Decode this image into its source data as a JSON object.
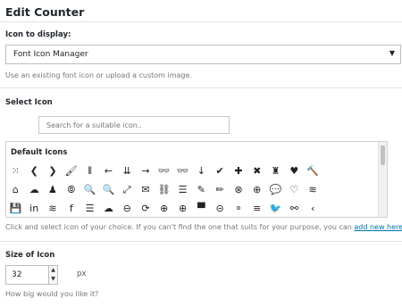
{
  "header": {
    "title": "Edit Counter"
  },
  "icon_display": {
    "label": "Icon to display:",
    "selected": "Font Icon Manager",
    "caret": "▼",
    "help": "Use an existing font icon or upload a custom image."
  },
  "select_icon": {
    "label": "Select Icon",
    "search_placeholder": "Search for a suitable icon..",
    "panel_title": "Default Icons",
    "rows": [
      [
        "⁙",
        "❮",
        "❯",
        "🖌",
        "⦀",
        "←",
        "⇊",
        "→",
        "👓",
        "👓",
        "↓",
        "✔",
        "✚",
        "✖",
        "♜",
        "♥",
        "🔨"
      ],
      [
        "⌂",
        "☁",
        "♟",
        "⦾",
        "🔍",
        "🔍",
        "⤢",
        "✉",
        "⛓",
        "☰",
        "✎",
        "✏",
        "⊗",
        "⊕",
        "💬",
        "♡",
        "≋"
      ],
      [
        "💾",
        "in",
        "≋",
        "f",
        "☰",
        "☁",
        "⊖",
        "⟳",
        "⊕",
        "⊕",
        "▀",
        "⊝",
        "⚬",
        "≡",
        "🐦",
        "⚯",
        "‹"
      ]
    ],
    "help_prefix": "Click and select icon of your choice. If you can't find the one that suits for your purpose, you can ",
    "help_link": "add new here",
    "help_suffix": "."
  },
  "size": {
    "label": "Size of Icon",
    "value": "32",
    "up": "▲",
    "down": "▼",
    "unit": "px",
    "help": "How big would you like it?"
  }
}
